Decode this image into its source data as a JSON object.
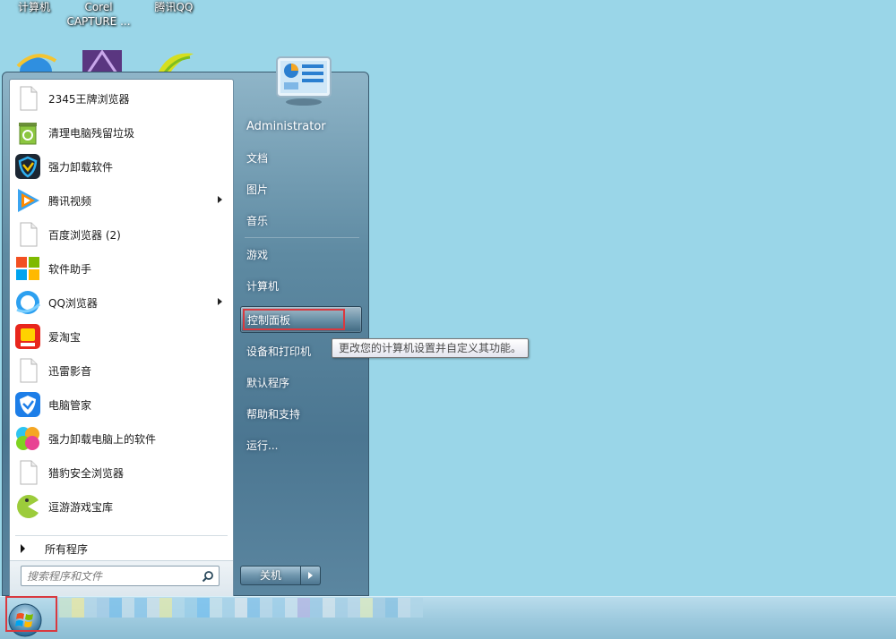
{
  "desktop": {
    "icons": [
      {
        "label": "计算机",
        "label2": ""
      },
      {
        "label": "Corel",
        "label2": "CAPTURE ..."
      },
      {
        "label": "腾讯QQ",
        "label2": ""
      }
    ]
  },
  "start_menu": {
    "programs": [
      {
        "label": "2345王牌浏览器",
        "icon": "blank-file-icon",
        "submenu": false
      },
      {
        "label": "清理电脑残留垃圾",
        "icon": "recycle-bin-icon",
        "submenu": false
      },
      {
        "label": "强力卸载软件",
        "icon": "uninstaller-shield-icon",
        "submenu": false
      },
      {
        "label": "腾讯视频",
        "icon": "tencent-video-icon",
        "submenu": true
      },
      {
        "label": "百度浏览器 (2)",
        "icon": "blank-file-icon",
        "submenu": false
      },
      {
        "label": "软件助手",
        "icon": "tiles-icon",
        "submenu": false
      },
      {
        "label": "QQ浏览器",
        "icon": "qq-browser-icon",
        "submenu": true
      },
      {
        "label": "爱淘宝",
        "icon": "taobao-icon",
        "submenu": false
      },
      {
        "label": "迅雷影音",
        "icon": "blank-file-icon",
        "submenu": false
      },
      {
        "label": "电脑管家",
        "icon": "pc-manager-icon",
        "submenu": false
      },
      {
        "label": "强力卸载电脑上的软件",
        "icon": "pinwheel-icon",
        "submenu": false
      },
      {
        "label": "猎豹安全浏览器",
        "icon": "blank-file-icon",
        "submenu": false
      },
      {
        "label": "逗游游戏宝库",
        "icon": "game-pacman-icon",
        "submenu": false
      }
    ],
    "all_programs": "所有程序",
    "search_placeholder": "搜索程序和文件",
    "right": {
      "username": "Administrator",
      "documents": "文档",
      "pictures": "图片",
      "music": "音乐",
      "games": "游戏",
      "computer": "计算机",
      "control_panel": "控制面板",
      "devices_printers": "设备和打印机",
      "default_programs": "默认程序",
      "help_support": "帮助和支持",
      "run": "运行..."
    },
    "shutdown_label": "关机",
    "tooltip": "更改您的计算机设置并自定义其功能。"
  },
  "colors": {
    "desktop_bg": "#9ad6e8",
    "highlight_box": "#d9393f"
  }
}
